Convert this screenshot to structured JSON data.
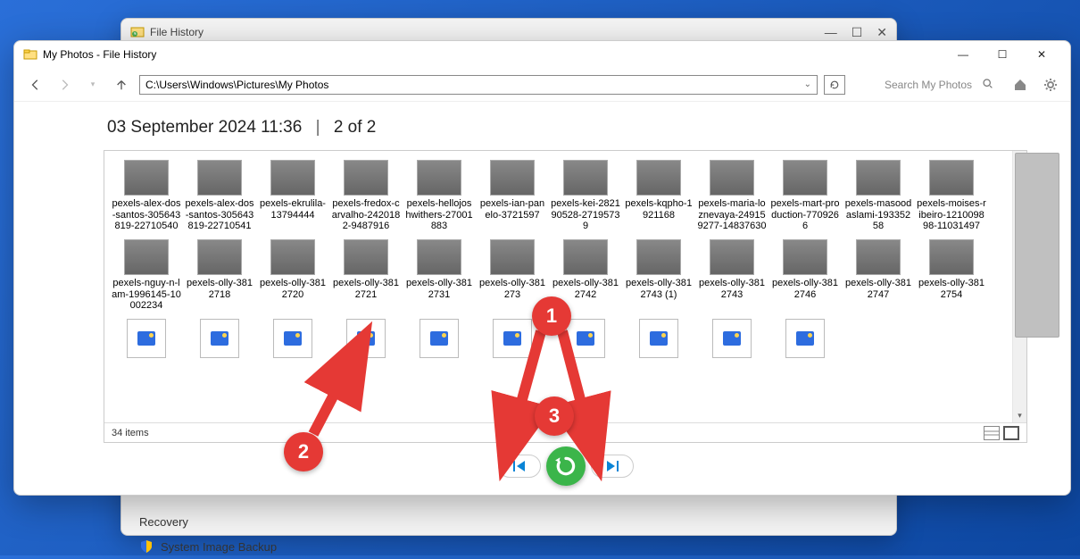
{
  "bg_window": {
    "title": "File History",
    "recovery": "Recovery",
    "system_image": "System Image Backup"
  },
  "fg_window": {
    "title": "My Photos - File History"
  },
  "address_path": "C:\\Users\\Windows\\Pictures\\My Photos",
  "search_placeholder": "Search My Photos",
  "header": {
    "timestamp": "03 September 2024 11:36",
    "page": "2 of 2"
  },
  "status": {
    "count": "34 items"
  },
  "controls": {
    "prev": "Previous version",
    "restore": "Restore",
    "next": "Next version"
  },
  "annotations": [
    {
      "n": "1"
    },
    {
      "n": "2"
    },
    {
      "n": "3"
    }
  ],
  "files_row1": [
    {
      "label": "pexels-alex-dos-santos-305643819-22710540",
      "thumb": "t-dark"
    },
    {
      "label": "pexels-alex-dos-santos-305643819-22710541",
      "thumb": "t-dark"
    },
    {
      "label": "pexels-ekrulila-13794444",
      "thumb": "t-sky"
    },
    {
      "label": "pexels-fredox-carvalho-2420182-9487916",
      "thumb": "t-sky"
    },
    {
      "label": "pexels-hellojoshwithers-27001883",
      "thumb": "t-road"
    },
    {
      "label": "pexels-ian-panelo-3721597",
      "thumb": "t-hand"
    },
    {
      "label": "pexels-kei-282190528-27195739",
      "thumb": "t-dark3"
    },
    {
      "label": "pexels-kqpho-1921168",
      "thumb": "t-dark3"
    },
    {
      "label": "pexels-maria-loznevaya-249159277-14837630",
      "thumb": "t-model"
    },
    {
      "label": "pexels-mart-production-7709266",
      "thumb": "t-white"
    },
    {
      "label": "pexels-masoodaslami-19335258",
      "thumb": "t-phone"
    },
    {
      "label": "pexels-moises-ribeiro-121009898-11031497",
      "thumb": "t-white"
    }
  ],
  "files_row2": [
    {
      "label": "pexels-nguy-n-lam-1996145-10002234",
      "thumb": "t-white"
    },
    {
      "label": "pexels-olly-3812718",
      "thumb": "t-model"
    },
    {
      "label": "pexels-olly-3812720",
      "thumb": "t-model"
    },
    {
      "label": "pexels-olly-3812721",
      "thumb": "t-model"
    },
    {
      "label": "pexels-olly-3812731",
      "thumb": "t-model"
    },
    {
      "label": "pexels-olly-381273",
      "thumb": "t-model"
    },
    {
      "label": "pexels-olly-3812742",
      "thumb": "t-model"
    },
    {
      "label": "pexels-olly-3812743 (1)",
      "thumb": "t-grid"
    },
    {
      "label": "pexels-olly-3812743",
      "thumb": "t-grid"
    },
    {
      "label": "pexels-olly-3812746",
      "thumb": "t-model"
    },
    {
      "label": "pexels-olly-3812747",
      "thumb": "t-model"
    },
    {
      "label": "pexels-olly-3812754",
      "thumb": "t-model"
    }
  ],
  "files_row3_count": 10
}
